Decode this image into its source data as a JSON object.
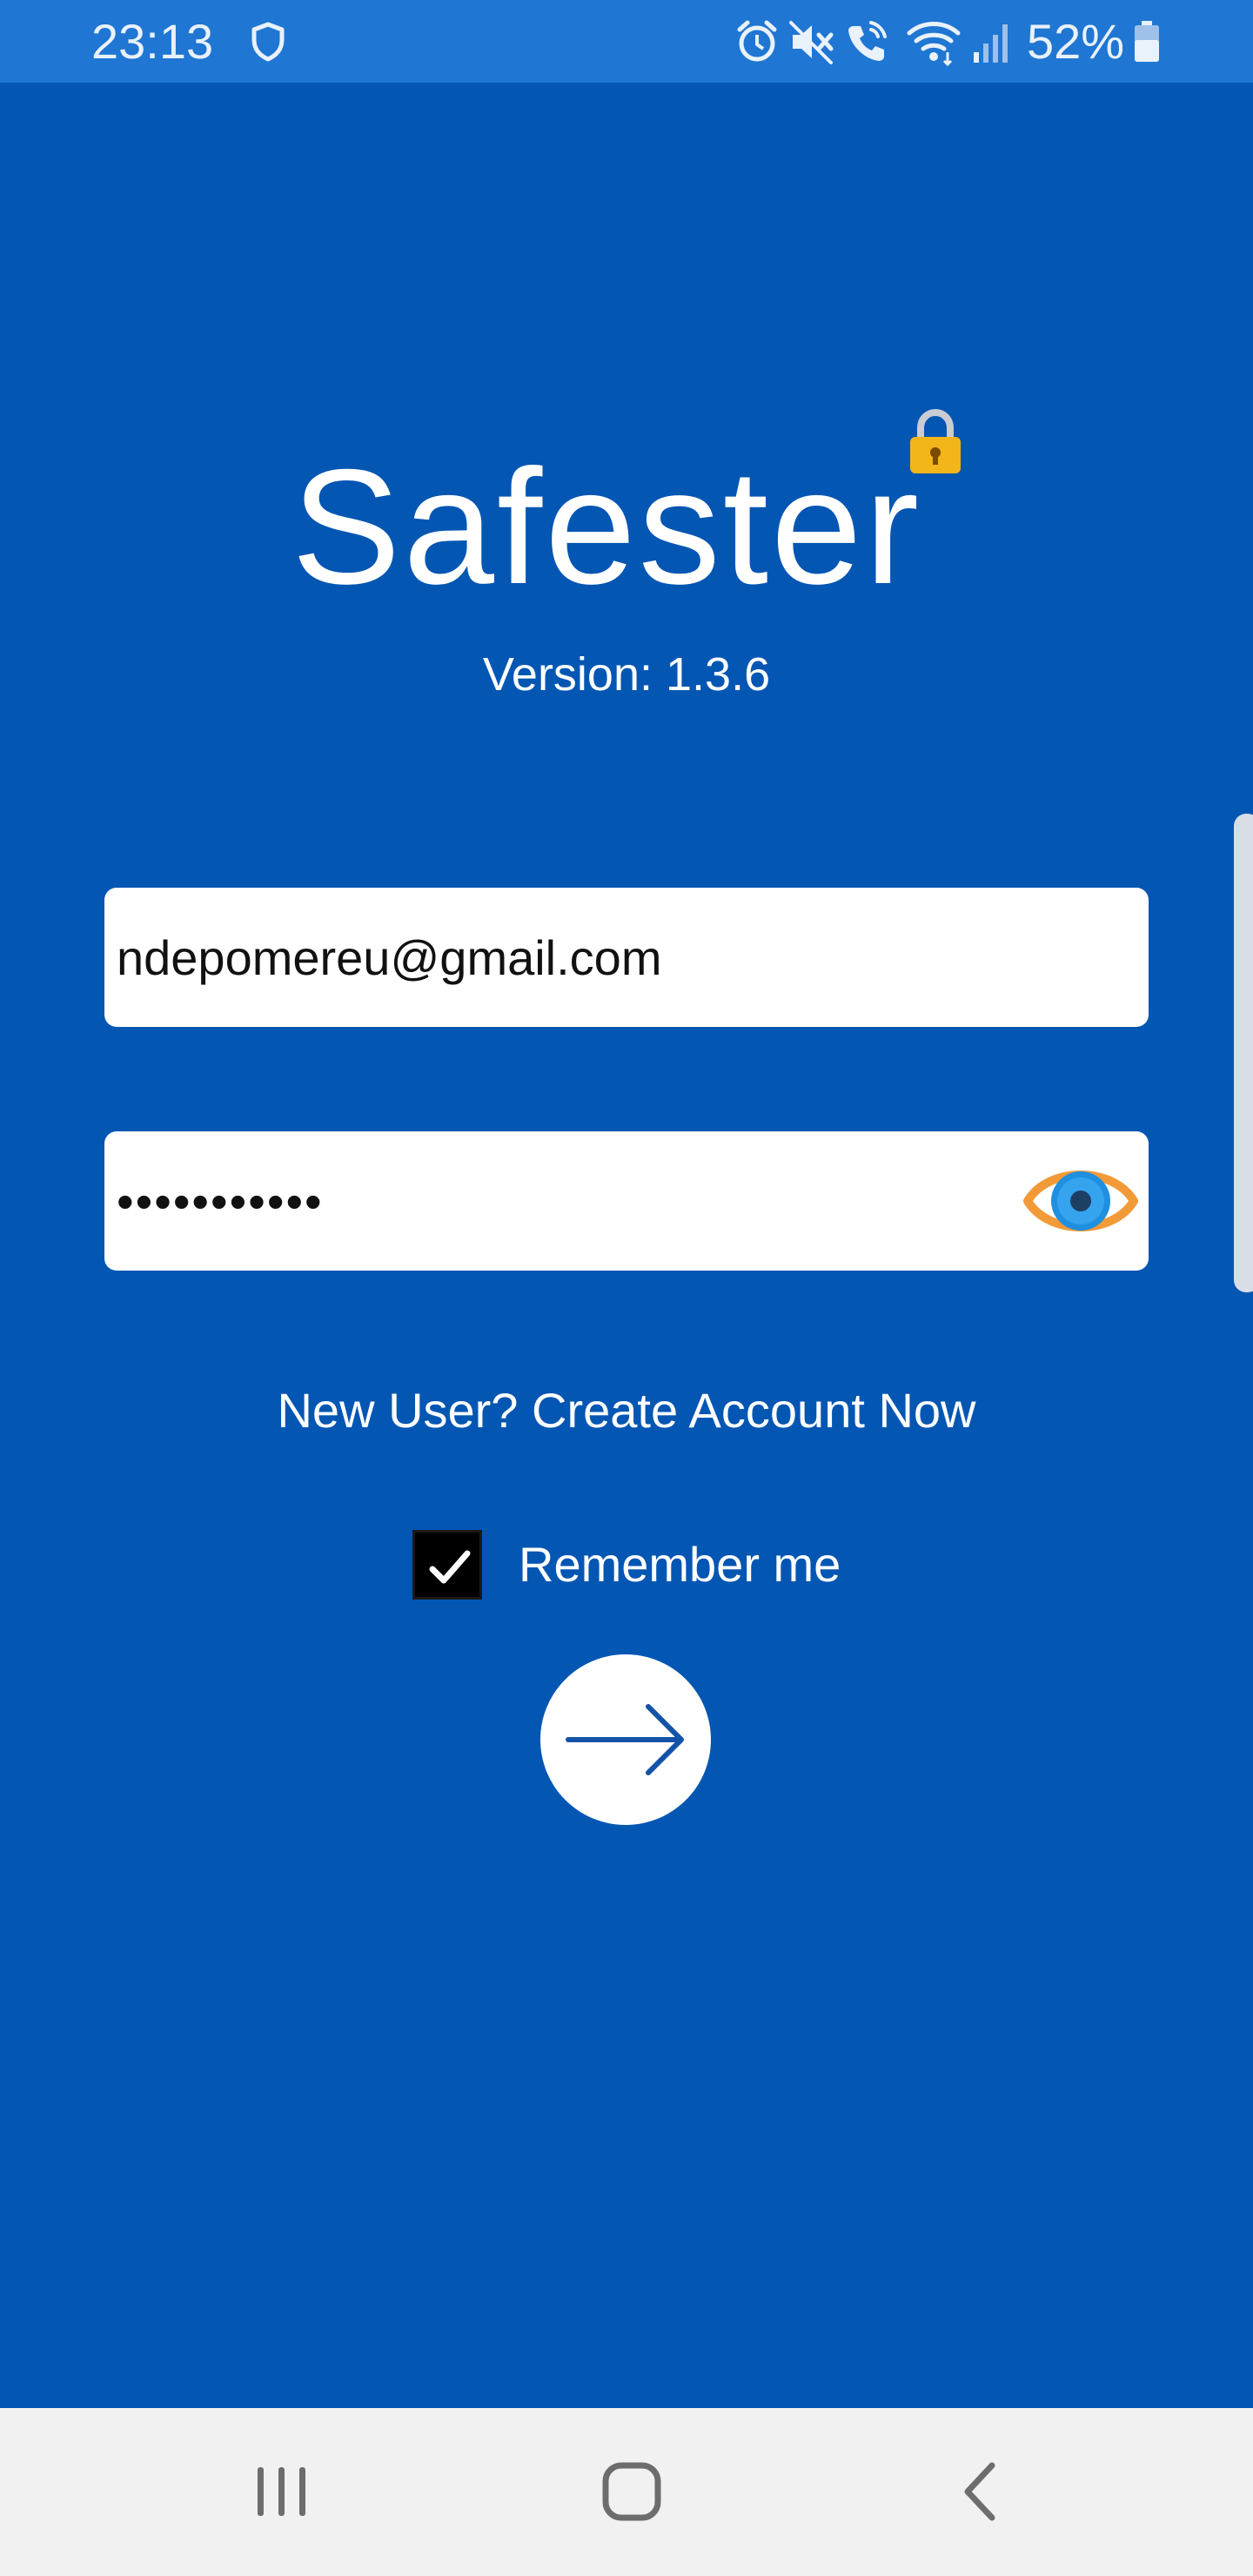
{
  "status_bar": {
    "time": "23:13",
    "battery_percent": "52%",
    "icons": [
      "shield-icon",
      "alarm-icon",
      "mute-icon",
      "wifi-call-icon",
      "wifi-icon",
      "signal-icon",
      "battery-icon"
    ]
  },
  "app": {
    "name": "Safester",
    "version_text": "Version: 1.3.6",
    "colors": {
      "background": "#0456b3",
      "status_bar": "#1f76d3",
      "lock_gold": "#f2b51a",
      "eye_orange": "#f39a38",
      "eye_blue": "#1f8fe0"
    }
  },
  "login_form": {
    "email_value": "ndepomereu@gmail.com",
    "password_value": "•••••••••••",
    "show_password_icon": "eye-icon",
    "create_account_link": "New User? Create Account Now",
    "remember_me_label": "Remember me",
    "remember_me_checked": true,
    "submit_icon": "arrow-right-icon"
  },
  "nav_bar": {
    "buttons": [
      "recents-icon",
      "home-icon",
      "back-icon"
    ]
  }
}
